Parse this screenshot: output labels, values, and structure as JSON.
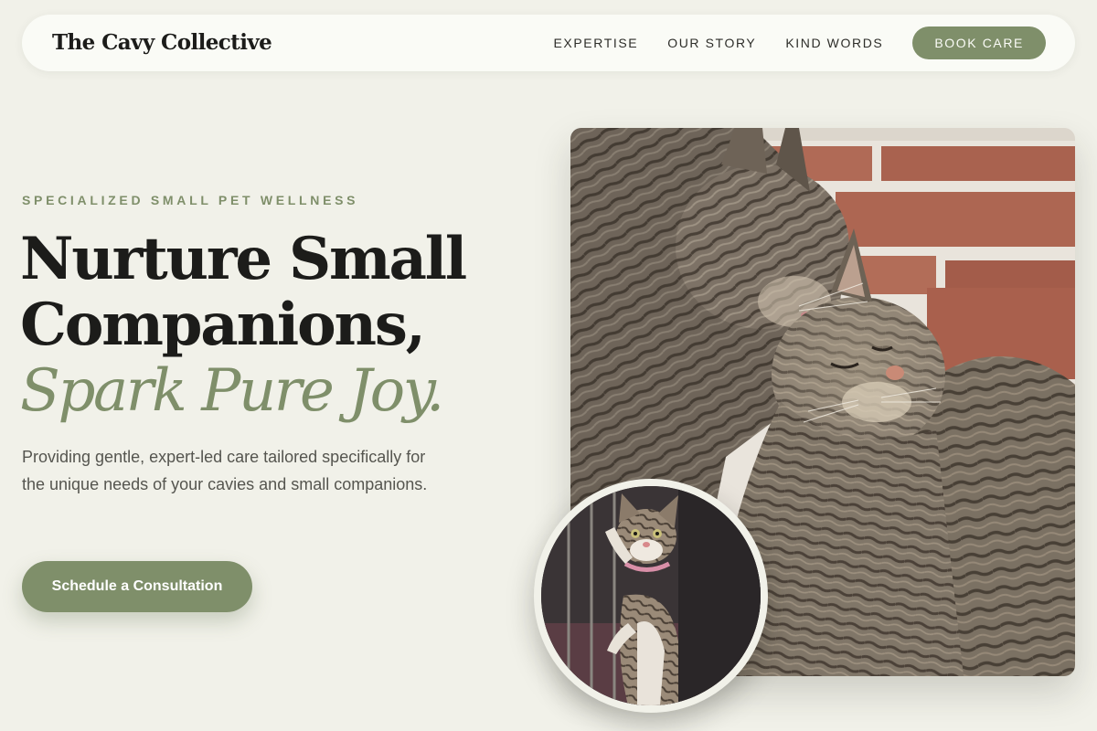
{
  "nav": {
    "brand": "The Cavy Collective",
    "links": [
      {
        "label": "EXPERTISE"
      },
      {
        "label": "OUR STORY"
      },
      {
        "label": "KIND WORDS"
      }
    ],
    "cta_label": "BOOK CARE"
  },
  "hero": {
    "eyebrow": "SPECIALIZED SMALL PET WELLNESS",
    "headline_line1": "Nurture Small",
    "headline_line2": "Companions,",
    "headline_accent": "Spark Pure Joy.",
    "subtext": "Providing gentle, expert-led care tailored specifically for the unique needs of your cavies and small companions.",
    "cta_label": "Schedule a Consultation"
  },
  "images": {
    "main": {
      "name": "two-tabby-cats-photo"
    },
    "inset": {
      "name": "kitten-climbing-cage-photo"
    }
  },
  "colors": {
    "page_background": "#f1f1e9",
    "nav_background": "#fafbf6",
    "accent": "#7f8f6a",
    "text_dark": "#1c1c1a",
    "text_muted": "#55554f"
  }
}
